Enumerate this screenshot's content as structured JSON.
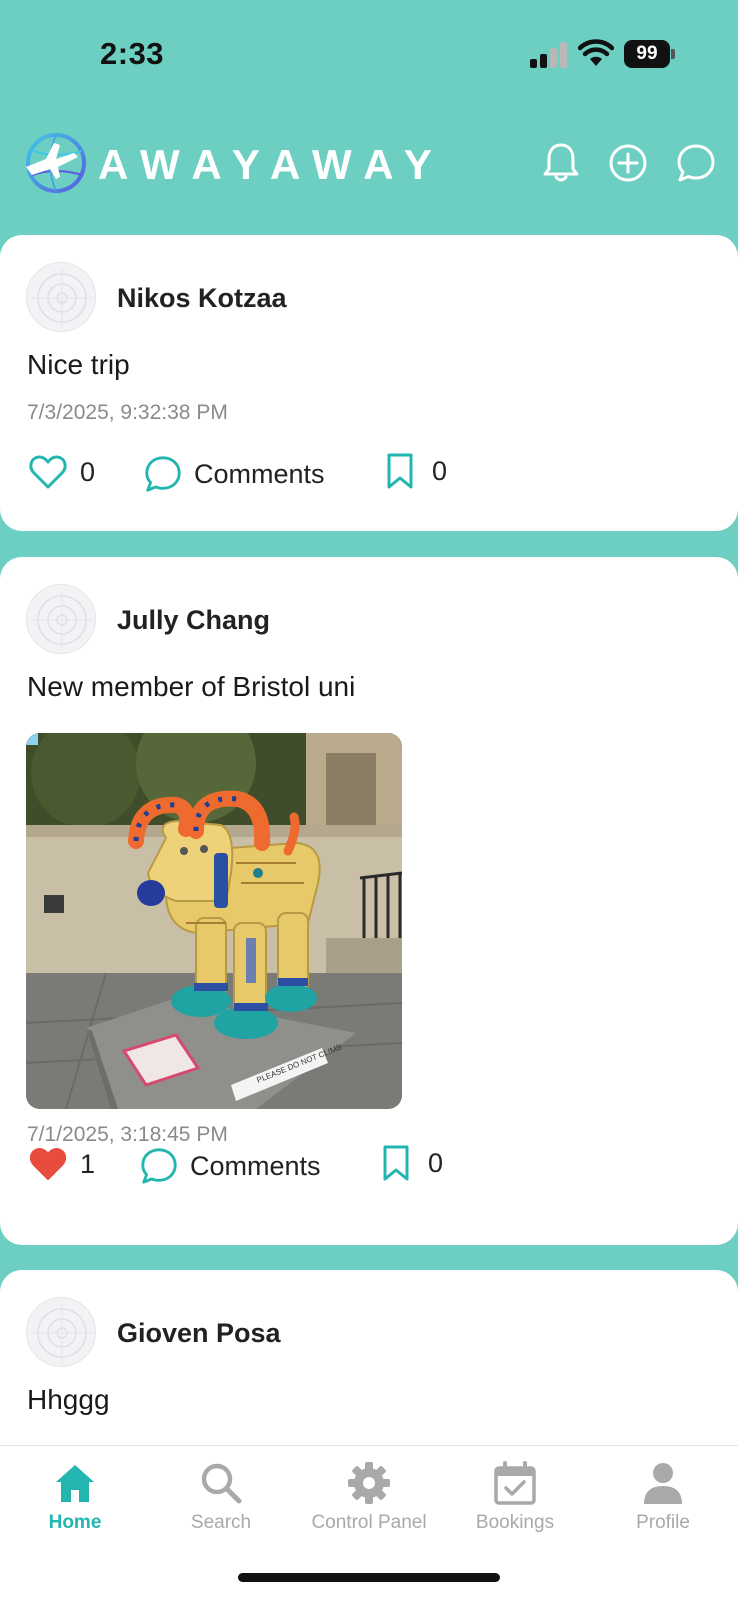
{
  "status_bar": {
    "time": "2:33",
    "battery": "99"
  },
  "header": {
    "brand": "AWAYAWAY",
    "icons": [
      "airplane-globe-logo-icon",
      "bell-icon",
      "plus-circle-icon",
      "chat-bubble-icon"
    ]
  },
  "colors": {
    "background": "#6ccfc1",
    "accent": "#23b5b0",
    "heart_active": "#e84c3d",
    "nav_inactive": "#a9a9a9"
  },
  "posts": [
    {
      "author": "Nikos Kotzaa",
      "text": "Nice trip",
      "timestamp": "7/3/2025, 9:32:38 PM",
      "likes": "0",
      "liked": false,
      "comments_label": "Comments",
      "saves": "0",
      "has_image": false
    },
    {
      "author": "Jully Chang",
      "text": "New member of Bristol uni",
      "timestamp": "7/1/2025, 3:18:45 PM",
      "likes": "1",
      "liked": true,
      "comments_label": "Comments",
      "saves": "0",
      "has_image": true,
      "image_alt": "Painted Gromit-style sculpture with ram horns and Egyptian motifs",
      "image_sign_text": "PLEASE DO NOT CLIMB"
    },
    {
      "author": "Gioven Posa",
      "text": "Hhggg"
    }
  ],
  "nav": {
    "items": [
      {
        "label": "Home",
        "icon": "home-icon",
        "active": true
      },
      {
        "label": "Search",
        "icon": "search-icon",
        "active": false
      },
      {
        "label": "Control Panel",
        "icon": "gear-icon",
        "active": false
      },
      {
        "label": "Bookings",
        "icon": "calendar-check-icon",
        "active": false
      },
      {
        "label": "Profile",
        "icon": "person-icon",
        "active": false
      }
    ]
  }
}
